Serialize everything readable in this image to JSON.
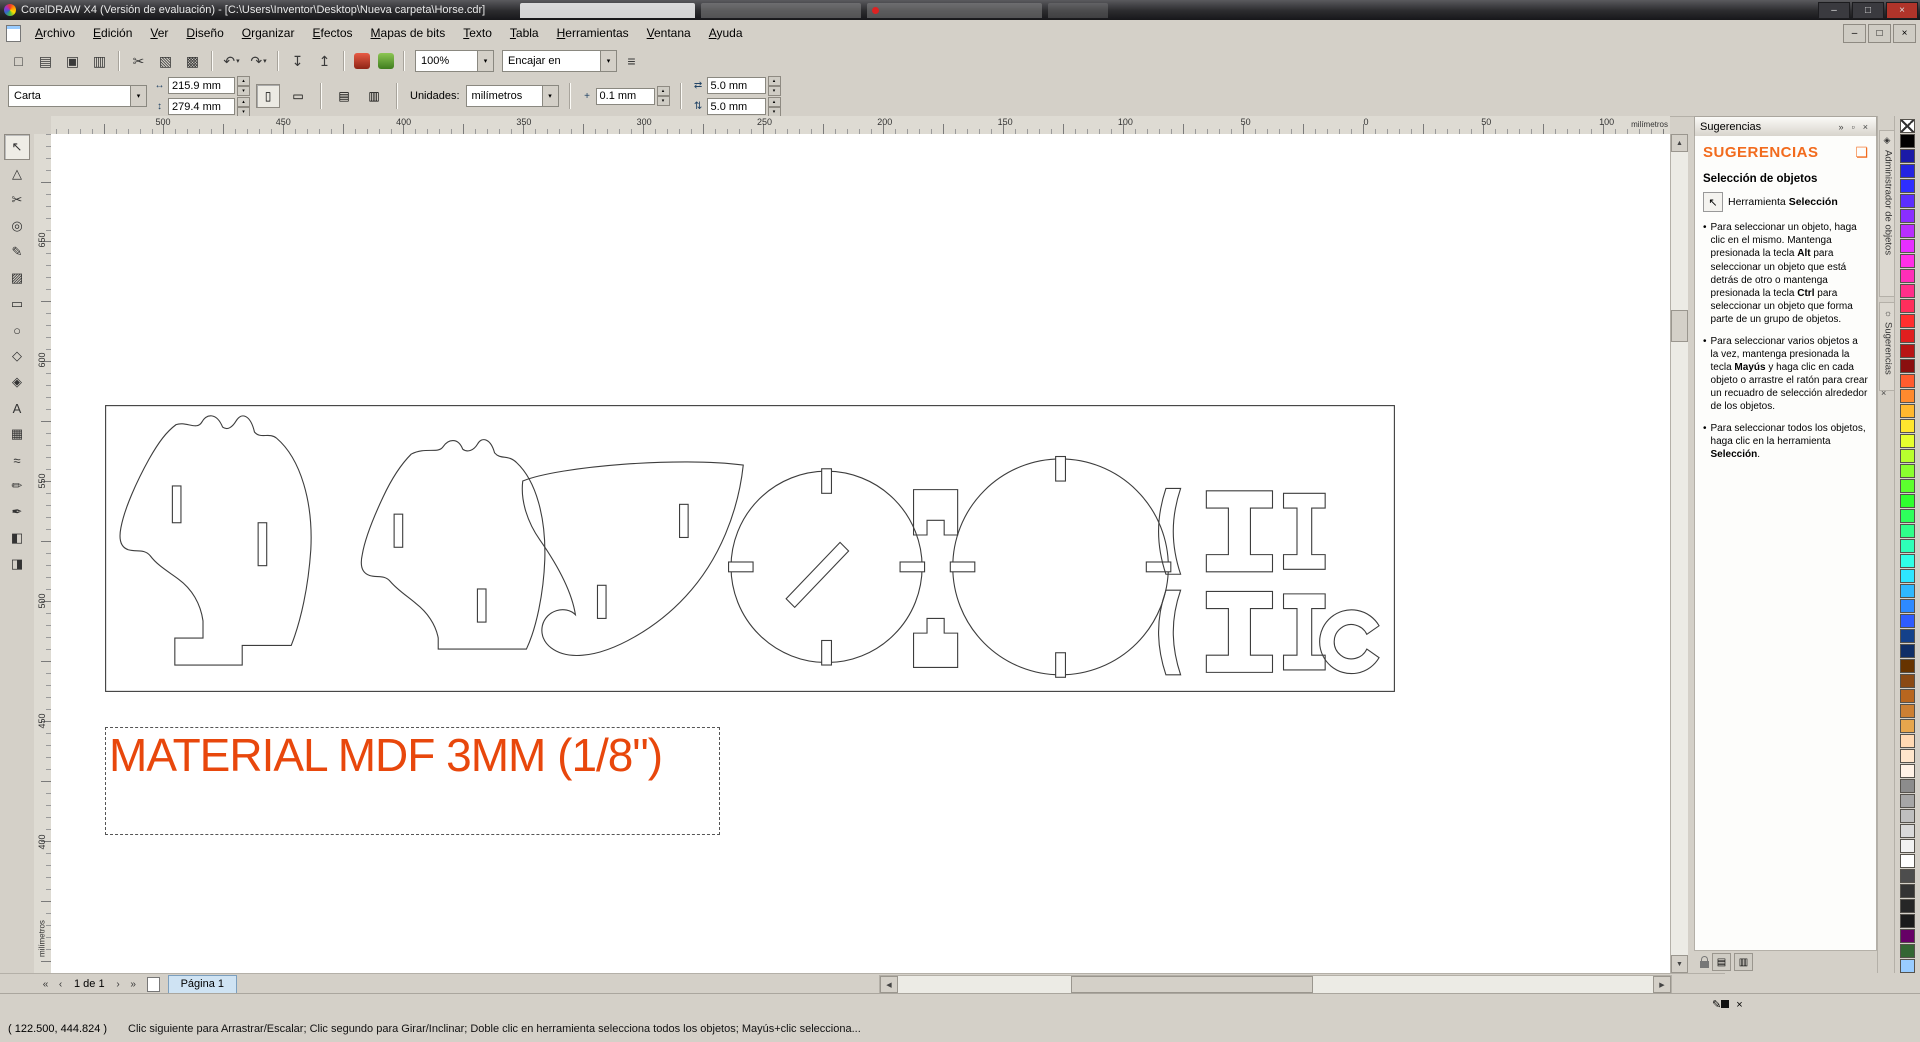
{
  "window": {
    "title": "CorelDRAW X4 (Versión de evaluación) - [C:\\Users\\Inventor\\Desktop\\Nueva carpeta\\Horse.cdr]"
  },
  "menubar": {
    "items": [
      "Archivo",
      "Edición",
      "Ver",
      "Diseño",
      "Organizar",
      "Efectos",
      "Mapas de bits",
      "Texto",
      "Tabla",
      "Herramientas",
      "Ventana",
      "Ayuda"
    ]
  },
  "standard_toolbar": {
    "zoom_level": "100%",
    "snap_label": "Encajar en",
    "buttons": [
      {
        "name": "new-document-button",
        "glyph": "□"
      },
      {
        "name": "open-button",
        "glyph": "▤"
      },
      {
        "name": "save-button",
        "glyph": "▣"
      },
      {
        "name": "print-button",
        "glyph": "▥"
      },
      {
        "sep": true
      },
      {
        "name": "cut-button",
        "glyph": "✂"
      },
      {
        "name": "copy-button",
        "glyph": "▧"
      },
      {
        "name": "paste-button",
        "glyph": "▩"
      },
      {
        "sep": true
      },
      {
        "name": "undo-button",
        "glyph": "↶",
        "dd": true
      },
      {
        "name": "redo-button",
        "glyph": "↷",
        "dd": true
      },
      {
        "sep": true
      },
      {
        "name": "import-button",
        "glyph": "↧"
      },
      {
        "name": "export-button",
        "glyph": "↥"
      },
      {
        "sep": true
      },
      {
        "name": "application-launcher-button",
        "app": "red"
      },
      {
        "name": "welcome-screen-button",
        "app": "green"
      },
      {
        "sep": true
      }
    ]
  },
  "property_bar": {
    "paper_size": "Carta",
    "page_width": "215.9 mm",
    "page_height": "279.4 mm",
    "units_label": "Unidades:",
    "units": "milímetros",
    "nudge_offset": "0.1 mm",
    "duplicate_x": "5.0 mm",
    "duplicate_y": "5.0 mm"
  },
  "toolbox": {
    "tools": [
      {
        "name": "pick-tool",
        "glyph": "↖",
        "active": true
      },
      {
        "name": "shape-tool",
        "glyph": "△"
      },
      {
        "name": "crop-tool",
        "glyph": "✂"
      },
      {
        "name": "zoom-tool",
        "glyph": "◎"
      },
      {
        "name": "freehand-tool",
        "glyph": "✎"
      },
      {
        "name": "smart-fill-tool",
        "glyph": "▨"
      },
      {
        "name": "rectangle-tool",
        "glyph": "▭"
      },
      {
        "name": "ellipse-tool",
        "glyph": "○"
      },
      {
        "name": "polygon-tool",
        "glyph": "◇"
      },
      {
        "name": "basic-shapes-tool",
        "glyph": "◈"
      },
      {
        "name": "text-tool",
        "glyph": "A"
      },
      {
        "name": "table-tool",
        "glyph": "▦"
      },
      {
        "name": "interactive-blend-tool",
        "glyph": "≈"
      },
      {
        "name": "eyedropper-tool",
        "glyph": "✏"
      },
      {
        "name": "outline-pen-tool",
        "glyph": "✒"
      },
      {
        "name": "fill-tool",
        "glyph": "◧"
      },
      {
        "name": "interactive-fill-tool",
        "glyph": "◨"
      }
    ]
  },
  "rulers": {
    "horizontal_ticks": [
      "500",
      "450",
      "400",
      "350",
      "300",
      "250",
      "200",
      "150",
      "100",
      "50",
      "0",
      "50",
      "100"
    ],
    "vertical_ticks": [
      "650",
      "600",
      "550",
      "500",
      "450",
      "400"
    ],
    "unit_label": "milímetros"
  },
  "canvas": {
    "material_label": "MATERIAL MDF 3MM (1/8\")",
    "material_color": "#e8470c"
  },
  "hints_docker": {
    "titlebar": "Sugerencias",
    "brand": "SUGERENCIAS",
    "section_title": "Selección de objetos",
    "tool_label_prefix": "Herramienta",
    "tool_label_bold": "Selección",
    "bullets": [
      [
        {
          "t": "Para seleccionar un objeto, haga clic en el mismo. Mantenga presionada la tecla "
        },
        {
          "t": "Alt",
          "b": true
        },
        {
          "t": " para seleccionar un objeto que está detrás de otro o mantenga presionada la tecla "
        },
        {
          "t": "Ctrl",
          "b": true
        },
        {
          "t": " para seleccionar un objeto que forma parte de un grupo de objetos."
        }
      ],
      [
        {
          "t": "Para seleccionar varios objetos a la vez, mantenga presionada la tecla "
        },
        {
          "t": "Mayús",
          "b": true
        },
        {
          "t": " y haga clic en cada objeto o arrastre el ratón para crear un recuadro de selección alrededor de los objetos."
        }
      ],
      [
        {
          "t": "Para seleccionar todos los objetos, haga clic en la herramienta "
        },
        {
          "t": "Selección",
          "b": true
        },
        {
          "t": "."
        }
      ]
    ]
  },
  "side_tabs": {
    "tabs": [
      {
        "label": "Administrador de objetos",
        "icon": "◈"
      },
      {
        "label": "Sugerencias",
        "icon": "☼"
      }
    ]
  },
  "palette": {
    "colors": [
      "none",
      "#000000",
      "#1a1aa6",
      "#2424e0",
      "#2e2eff",
      "#5c2eff",
      "#8a2eff",
      "#b82eff",
      "#e62eff",
      "#ff2ee6",
      "#ff2eb8",
      "#ff2e8a",
      "#ff2e5c",
      "#ff2e2e",
      "#e01f1f",
      "#b81414",
      "#8a0f0f",
      "#ff5c2e",
      "#ff8a2e",
      "#ffb82e",
      "#ffe62e",
      "#e6ff2e",
      "#b8ff2e",
      "#8aff2e",
      "#5cff2e",
      "#2eff2e",
      "#2eff5c",
      "#2eff8a",
      "#2effb8",
      "#2effe6",
      "#2ee6ff",
      "#2eb8ff",
      "#2e8aff",
      "#2e5cff",
      "#14418a",
      "#0f2e66",
      "#663300",
      "#8a4a14",
      "#b8661f",
      "#cc8033",
      "#e6a64d",
      "#ffd9b3",
      "#ffe6cc",
      "#fff2e6",
      "#8c8c8c",
      "#a6a6a6",
      "#bfbfbf",
      "#d9d9d9",
      "#f2f2f2",
      "#ffffff",
      "#4d4d4d",
      "#333333",
      "#262626",
      "#1a1a1a",
      "#660066",
      "#336633",
      "#99ccff"
    ]
  },
  "page_controls": {
    "page_counter": "1 de 1",
    "page_tab": "Página 1"
  },
  "status_bar": {
    "coordinates": "( 122.500, 444.824 )",
    "hint": "Clic siguiente para Arrastrar/Escalar; Clic segundo para Girar/Inclinar; Doble clic en herramienta selecciona todos los objetos; Mayús+clic selecciona..."
  }
}
